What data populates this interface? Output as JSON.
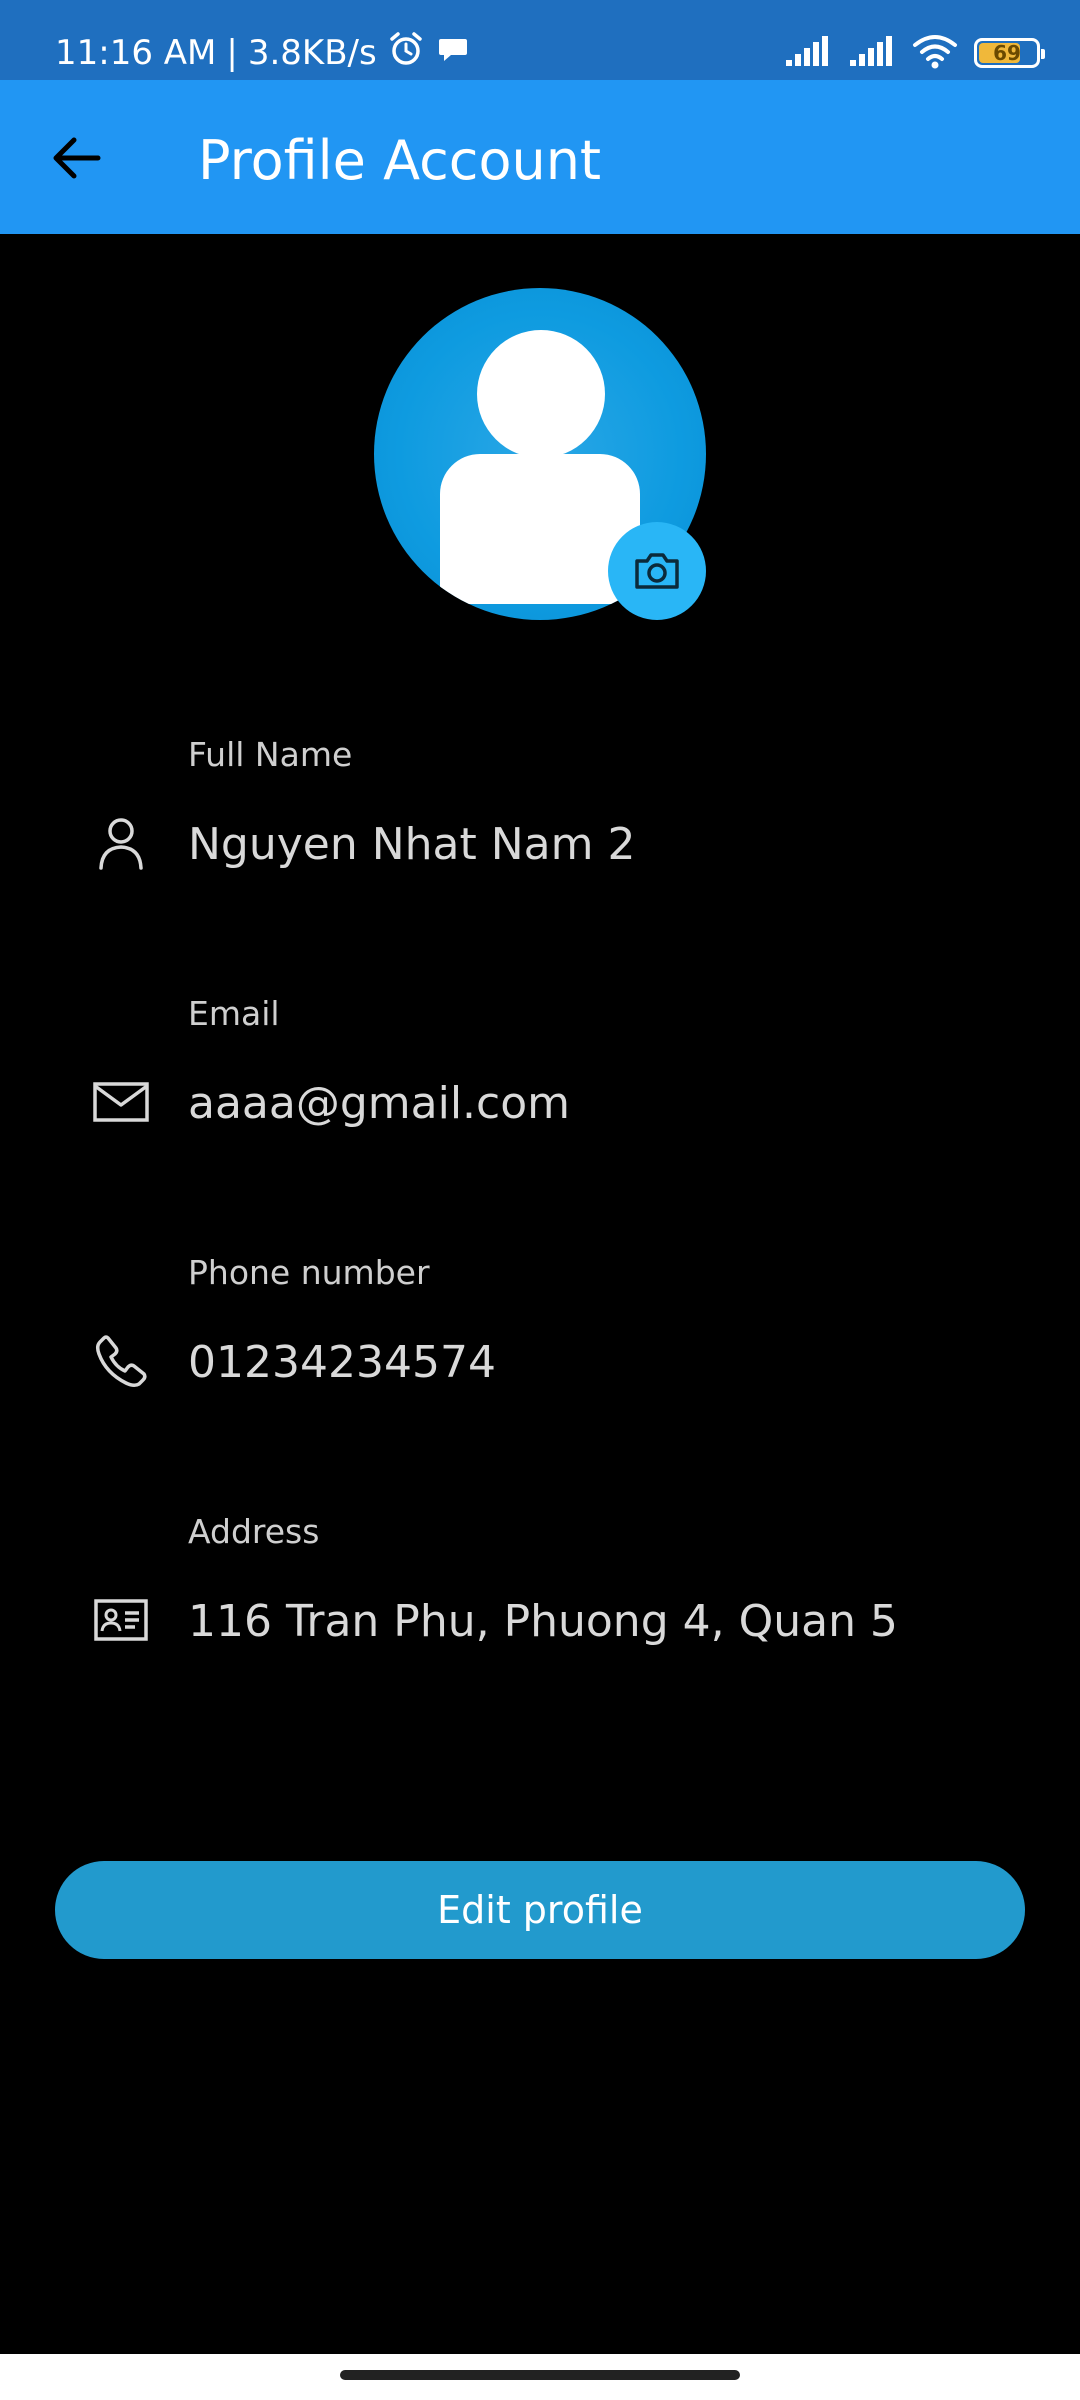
{
  "status_bar": {
    "time": "11:16 AM",
    "separator": "|",
    "network_speed": "3.8KB/s",
    "battery_level": "69",
    "icons": [
      "alarm-icon",
      "message-icon",
      "signal-icon",
      "signal-icon",
      "wifi-icon",
      "battery-icon"
    ]
  },
  "app_bar": {
    "title": "Profile Account",
    "back_icon": "arrow-left-icon",
    "background_color": "#2196f3"
  },
  "avatar": {
    "icon": "default-user-avatar",
    "camera_icon": "camera-icon",
    "accent_color": "#29b6f6"
  },
  "fields": [
    {
      "label": "Full Name",
      "value": "Nguyen Nhat Nam 2",
      "icon": "person-icon"
    },
    {
      "label": "Email",
      "value": "aaaa@gmail.com",
      "icon": "mail-icon"
    },
    {
      "label": "Phone number",
      "value": "01234234574",
      "icon": "phone-icon"
    },
    {
      "label": "Address",
      "value": "116 Tran Phu, Phuong 4, Quan 5",
      "icon": "id-card-icon"
    }
  ],
  "edit_button": {
    "label": "Edit profile",
    "color": "#229acd"
  }
}
